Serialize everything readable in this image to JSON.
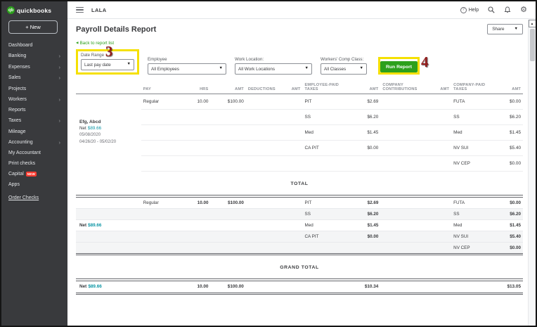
{
  "topbar": {
    "company": "LALA",
    "help_label": "Help"
  },
  "sidebar": {
    "brand": "quickbooks",
    "brand_mark": "qb",
    "new_button": "+ New",
    "items": [
      {
        "label": "Dashboard",
        "chevron": false
      },
      {
        "label": "Banking",
        "chevron": true
      },
      {
        "label": "Expenses",
        "chevron": true
      },
      {
        "label": "Sales",
        "chevron": true
      },
      {
        "label": "Projects",
        "chevron": false
      },
      {
        "label": "Workers",
        "chevron": true
      },
      {
        "label": "Reports",
        "chevron": false
      },
      {
        "label": "Taxes",
        "chevron": true
      },
      {
        "label": "Mileage",
        "chevron": false
      },
      {
        "label": "Accounting",
        "chevron": true
      },
      {
        "label": "My Accountant",
        "chevron": false
      },
      {
        "label": "Print checks",
        "chevron": false
      },
      {
        "label": "Capital",
        "chevron": false,
        "badge": "NEW"
      },
      {
        "label": "Apps",
        "chevron": false
      },
      {
        "label": "Order Checks",
        "chevron": false
      }
    ]
  },
  "page": {
    "title": "Payroll Details Report",
    "share_label": "Share",
    "back_link": "Back to report list"
  },
  "filters": {
    "date_range": {
      "label": "Date Range",
      "value": "Last pay date"
    },
    "employee": {
      "label": "Employee",
      "value": "All Employees"
    },
    "work_location": {
      "label": "Work Location:",
      "value": "All Work Locations"
    },
    "comp_class": {
      "label": "Workers' Comp Class:",
      "value": "All Classes"
    },
    "run_report_label": "Run Report"
  },
  "annotations": {
    "step3": "3",
    "step4": "4"
  },
  "colors": {
    "accent_green": "#2ca01c",
    "highlight_yellow": "#f5e003",
    "annotation_red": "#921d1d",
    "net_link_teal": "#0d96a5",
    "sidebar_dark": "#393a3d",
    "badge_red": "#ff3b30"
  },
  "icons": {
    "caret_down": "▾",
    "caret_down_solid": "▼",
    "scroll_up": "▲",
    "chevron_right": "›",
    "back_arrow": "◀",
    "gear": "⚙",
    "help": "?"
  },
  "report": {
    "headers": {
      "pay": "PAY",
      "hrs": "HRS",
      "amt1": "AMT",
      "deductions": "DEDUCTIONS",
      "amt2": "AMT",
      "employee_paid_taxes": "EMPLOYEE-PAID TAXES",
      "amt3": "AMT",
      "company_contributions": "COMPANY CONTRIBUTIONS",
      "amt4": "AMT",
      "company_paid_taxes": "COMPANY-PAID TAXES",
      "amt5": "AMT"
    },
    "employee": {
      "name": "Efg, Abcd",
      "net_label": "Net",
      "net_amount": "$89.66",
      "pay_date": "05/08/2020",
      "pay_period": "04/26/20 - 05/02/20"
    },
    "detail_rows": [
      {
        "pay": "Regular",
        "hrs": "10.00",
        "amt": "$100.00",
        "ept": "PIT",
        "ept_amt": "$2.69",
        "cpt": "FUTA",
        "cpt_amt": "$0.00"
      },
      {
        "ept": "SS",
        "ept_amt": "$6.20",
        "cpt": "SS",
        "cpt_amt": "$6.20"
      },
      {
        "ept": "Med",
        "ept_amt": "$1.45",
        "cpt": "Med",
        "cpt_amt": "$1.45"
      },
      {
        "ept": "CA PIT",
        "ept_amt": "$0.00",
        "cpt": "NV SUI",
        "cpt_amt": "$5.40"
      },
      {
        "cpt": "NV CEP",
        "cpt_amt": "$0.00"
      }
    ],
    "total": {
      "label": "TOTAL",
      "net_label": "Net",
      "net_amount": "$89.66",
      "rows": [
        {
          "pay": "Regular",
          "hrs": "10.00",
          "amt": "$100.00",
          "ept": "PIT",
          "ept_amt": "$2.69",
          "cpt": "FUTA",
          "cpt_amt": "$0.00"
        },
        {
          "ept": "SS",
          "ept_amt": "$6.20",
          "cpt": "SS",
          "cpt_amt": "$6.20"
        },
        {
          "ept": "Med",
          "ept_amt": "$1.45",
          "cpt": "Med",
          "cpt_amt": "$1.45"
        },
        {
          "ept": "CA PIT",
          "ept_amt": "$0.00",
          "cpt": "NV SUI",
          "cpt_amt": "$5.40"
        },
        {
          "cpt": "NV CEP",
          "cpt_amt": "$0.00"
        }
      ]
    },
    "grand_total": {
      "label": "GRAND TOTAL",
      "net_label": "Net",
      "net_amount": "$89.66",
      "hrs": "10.00",
      "amt": "$100.00",
      "ept_amt": "$10.34",
      "cpt_amt": "$13.05"
    }
  }
}
